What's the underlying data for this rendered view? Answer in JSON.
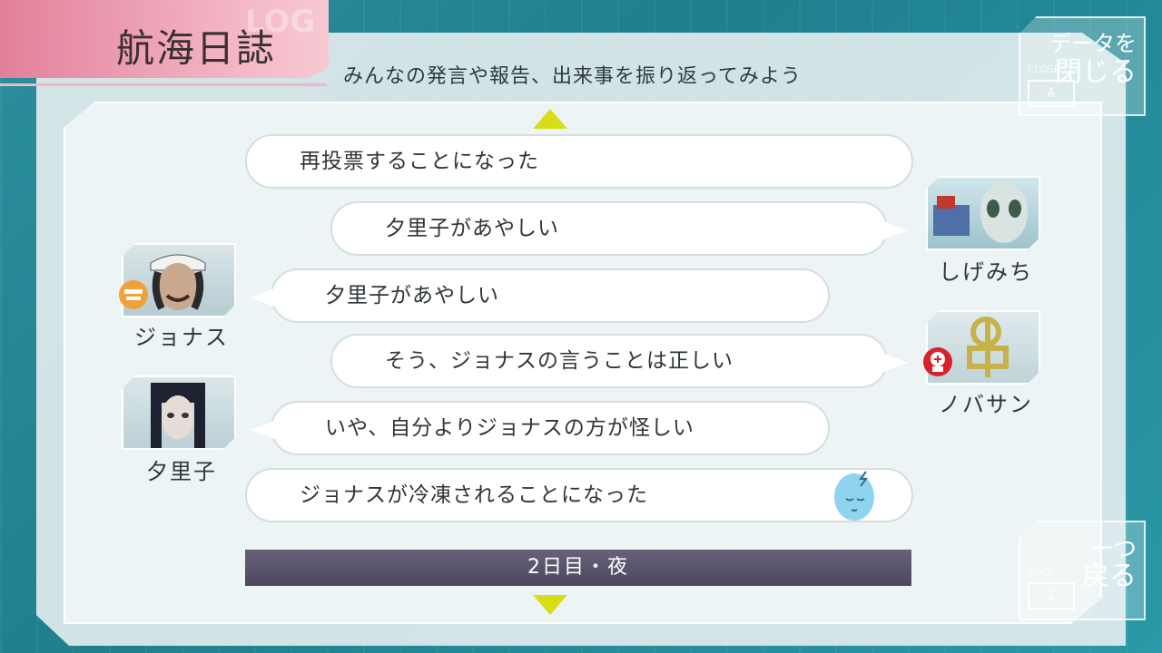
{
  "header": {
    "title": "航海日誌",
    "logo_ghost": "LOG",
    "subtitle": "みんなの発言や報告、出来事を振り返ってみよう"
  },
  "close_button": {
    "small_label": "CLOSE",
    "key": "A",
    "line1": "データを",
    "line2": "閉じる"
  },
  "back_button": {
    "small_label": "BACK",
    "key": "Z",
    "line1": "一つ",
    "line2": "戻る"
  },
  "log_entries": [
    {
      "text": "再投票することになった",
      "speaker": "",
      "side": "none"
    },
    {
      "text": "夕里子があやしい",
      "speaker": "しげみち",
      "side": "right"
    },
    {
      "text": "夕里子があやしい",
      "speaker": "ジョナス",
      "side": "left"
    },
    {
      "text": "そう、ジョナスの言うことは正しい",
      "speaker": "ノバサン",
      "side": "right"
    },
    {
      "text": "いや、自分よりジョナスの方が怪しい",
      "speaker": "夕里子",
      "side": "left"
    },
    {
      "text": "ジョナスが冷凍されることになった",
      "speaker": "",
      "side": "none"
    }
  ],
  "characters": {
    "shigemichi": {
      "name": "しげみち",
      "icon": "alien-portrait-icon"
    },
    "jonas": {
      "name": "ジョナス",
      "icon": "jonas-portrait-icon",
      "badge": "engineer-badge-icon"
    },
    "novasan": {
      "name": "ノバサン",
      "icon": "novasan-portrait-icon",
      "badge": "bug-badge-icon"
    },
    "yuriko": {
      "name": "夕里子",
      "icon": "yuriko-portrait-icon"
    }
  },
  "day_marker": "2日目・夜",
  "colors": {
    "accent_yellow": "#d8de16",
    "title_pink": "#e2809a",
    "background_teal": "#2c8f9c",
    "day_bar": "#4c475e"
  }
}
